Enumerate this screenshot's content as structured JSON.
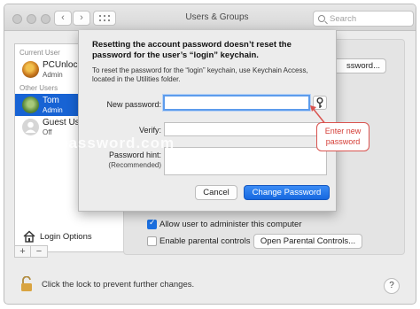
{
  "window": {
    "title": "Users & Groups",
    "search_placeholder": "Search"
  },
  "sidebar": {
    "section_current": "Current User",
    "section_other": "Other Users",
    "users": [
      {
        "name": "PCUnlocker",
        "role": "Admin",
        "avatar_color": "#c9781e"
      },
      {
        "name": "Tom",
        "role": "Admin",
        "avatar_color": "#5b8a3a",
        "selected": true
      },
      {
        "name": "Guest User",
        "role": "Off",
        "avatar_color": "#d0d0d0"
      }
    ],
    "login_options": "Login Options",
    "add_label": "+",
    "remove_label": "−"
  },
  "main": {
    "change_password_button_partial": "ssword...",
    "allow_admin_label": "Allow user to administer this computer",
    "allow_admin_checked": true,
    "parental_label": "Enable parental controls",
    "parental_checked": false,
    "open_parental_button": "Open Parental Controls..."
  },
  "lock": {
    "message": "Click the lock to prevent further changes.",
    "help": "?"
  },
  "sheet": {
    "heading": "Resetting the account password doesn’t reset the password for the user’s “login” keychain.",
    "description": "To reset the password for the “login” keychain, use Keychain Access, located in the Utilities folder.",
    "new_password_label": "New password:",
    "verify_label": "Verify:",
    "hint_label": "Password hint:",
    "hint_sub": "(Recommended)",
    "new_password_value": "",
    "verify_value": "",
    "hint_value": "",
    "cancel": "Cancel",
    "change": "Change Password"
  },
  "annotation": {
    "text": "Enter new password",
    "color": "#d43c35"
  },
  "watermark": "top-password.com",
  "accent_color": "#1763d4"
}
